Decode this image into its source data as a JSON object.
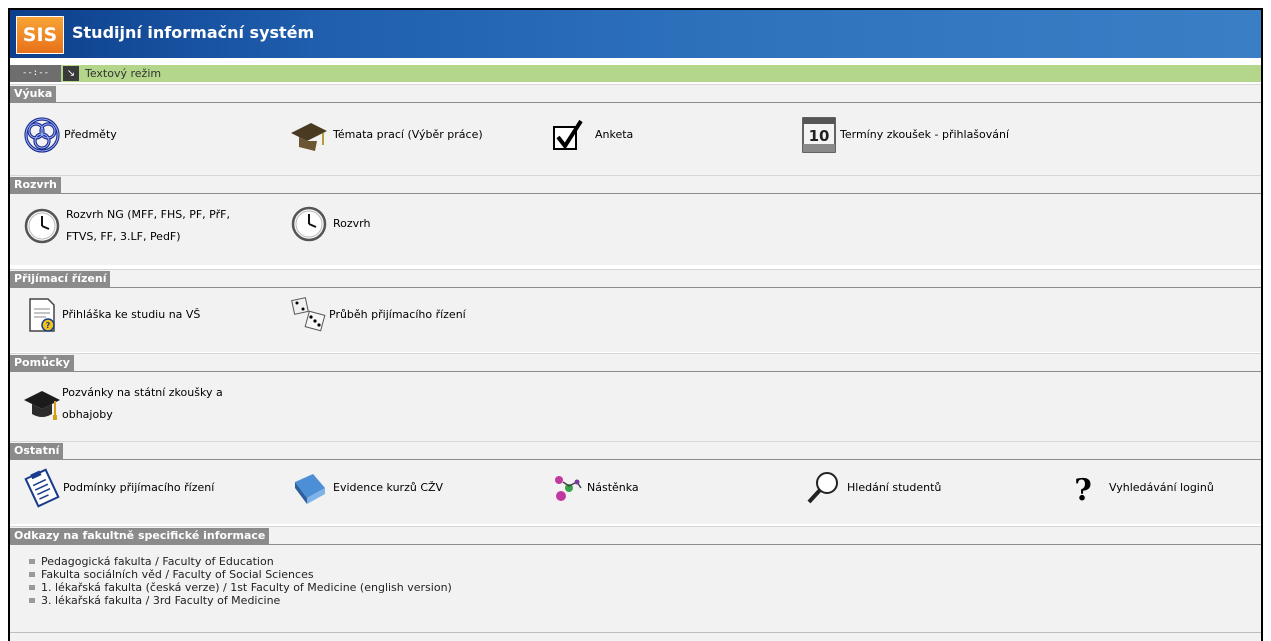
{
  "app": {
    "logo": "SIS",
    "title": "Studijní informační systém"
  },
  "toolbar": {
    "time": "--:--",
    "arrow": "↘",
    "mode_label": "Textový režim"
  },
  "sections": {
    "vyuka": {
      "title": "Výuka",
      "items": [
        {
          "label": "Předměty",
          "icon": "knot-icon"
        },
        {
          "label": "Témata prací (Výběr práce)",
          "icon": "graduation-cap-icon"
        },
        {
          "label": "Anketa",
          "icon": "checkbox-icon"
        },
        {
          "label": "Termíny zkoušek - přihlašování",
          "icon": "calendar-icon"
        }
      ]
    },
    "rozvrh": {
      "title": "Rozvrh",
      "items": [
        {
          "label": "Rozvrh NG (MFF, FHS, PF, PřF, FTVS, FF, 3.LF, PedF)",
          "icon": "clock-icon"
        },
        {
          "label": "Rozvrh",
          "icon": "clock-icon"
        }
      ]
    },
    "prijimaci": {
      "title": "Přijímací řízení",
      "items": [
        {
          "label": "Přihláška ke studiu na VŠ",
          "icon": "application-form-icon"
        },
        {
          "label": "Průběh přijímacího řízení",
          "icon": "dice-icon"
        }
      ]
    },
    "pomucky": {
      "title": "Pomůcky",
      "items": [
        {
          "label": "Pozvánky na státní zkoušky a obhajoby",
          "icon": "mortarboard-icon"
        }
      ]
    },
    "ostatni": {
      "title": "Ostatní",
      "items": [
        {
          "label": "Podmínky přijímacího řízení",
          "icon": "clipboard-icon"
        },
        {
          "label": "Evidence kurzů CŽV",
          "icon": "book-icon"
        },
        {
          "label": "Nástěnka",
          "icon": "pin-board-icon"
        },
        {
          "label": "Hledání studentů",
          "icon": "magnifier-icon"
        },
        {
          "label": "Vyhledávání loginů",
          "icon": "question-mark-icon"
        }
      ]
    },
    "odkazy": {
      "title": "Odkazy na fakultně specifické informace",
      "links": [
        "Pedagogická fakulta / Faculty of Education",
        "Fakulta sociálních věd / Faculty of Social Sciences",
        "1. lékařská fakulta (česká verze) / 1st Faculty of Medicine (english version)",
        "3. lékařská fakulta / 3rd Faculty of Medicine"
      ]
    }
  }
}
